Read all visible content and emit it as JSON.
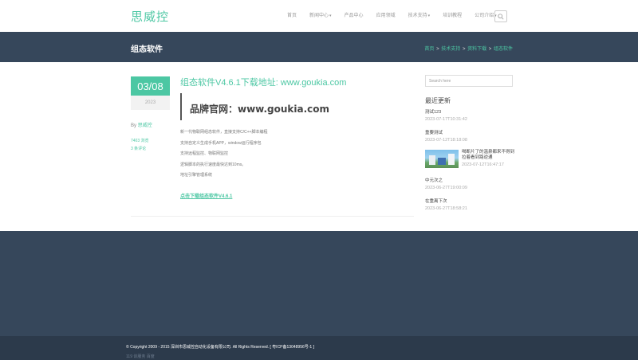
{
  "header": {
    "logo": "思威控",
    "nav": [
      {
        "label": "首页",
        "dropdown": false
      },
      {
        "label": "新闻中心",
        "dropdown": true
      },
      {
        "label": "产品中心",
        "dropdown": false
      },
      {
        "label": "应用领域",
        "dropdown": false
      },
      {
        "label": "技术支持",
        "dropdown": true
      },
      {
        "label": "培训教程",
        "dropdown": false
      },
      {
        "label": "公司介绍",
        "dropdown": true
      }
    ],
    "search_icon": "search-icon"
  },
  "titlebar": {
    "title": "组态软件",
    "breadcrumb": [
      "首页",
      "技术支持",
      "资料下载",
      "组态软件"
    ]
  },
  "post": {
    "date_md": "03/08",
    "date_year": "2023",
    "by_prefix": "By",
    "author": "思威控",
    "views": "7403 浏览",
    "comments": "3 条评论",
    "title": "组态软件V4.6.1下载地址: www.goukia.com",
    "quote": "品牌官网：www.goukia.com",
    "lines": [
      "新一代物联网组态软件，直接支持C/C++脚本编程",
      "支持自定义生成手机APP，window运行程序包",
      "支持远程监控、物联网监控",
      "逻辑脚本的执行速度最快达到10ms。",
      "地址引擎管理系统"
    ],
    "download_link": "点击下载组态软件V4.6.1"
  },
  "sidebar": {
    "search_placeholder": "Search here",
    "recent_title": "最近更新",
    "recent": [
      {
        "title": "测试123",
        "date": "2023-07-17T10:31:42"
      },
      {
        "title": "重要测试",
        "date": "2023-07-12T18:18:08"
      },
      {
        "title": "喝断片了的温泉都来不得到拉着看到路逆通",
        "date": "2023-07-12T16:47:17",
        "thumb": true
      },
      {
        "title": "中元次之",
        "date": "2023-06-27T19:00:09"
      },
      {
        "title": "在重离下次",
        "date": "2023-06-27T18:58:21"
      }
    ]
  },
  "footer": {
    "copyright": "© Copyright 2009 - 2015 深圳市思威控自动化设备有限公司. All Rights Reserved.  [ 粤ICP备13048956号-1 ]",
    "small": "119 训服务 百度"
  }
}
